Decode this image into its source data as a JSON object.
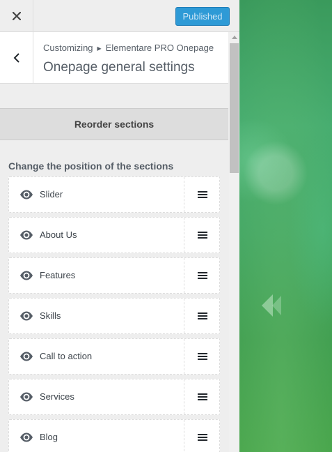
{
  "topbar": {
    "close_icon": "close-icon",
    "publish_label": "Published",
    "publish_color": "#2e9ad6"
  },
  "header": {
    "back_icon": "chevron-left-icon",
    "breadcrumb_root": "Customizing",
    "breadcrumb_separator_icon": "triangle-right-icon",
    "breadcrumb_current": "Elementare PRO Onepage",
    "title": "Onepage general settings"
  },
  "reorder": {
    "label": "Reorder sections"
  },
  "instructions": "Change the position of the sections",
  "sections": [
    {
      "label": "Slider"
    },
    {
      "label": "About Us"
    },
    {
      "label": "Features"
    },
    {
      "label": "Skills"
    },
    {
      "label": "Call to action"
    },
    {
      "label": "Services"
    },
    {
      "label": "Blog"
    }
  ],
  "icons": {
    "visibility": "eye-icon",
    "drag": "drag-handle-icon",
    "preview_nav": "chevron-left-icon"
  }
}
